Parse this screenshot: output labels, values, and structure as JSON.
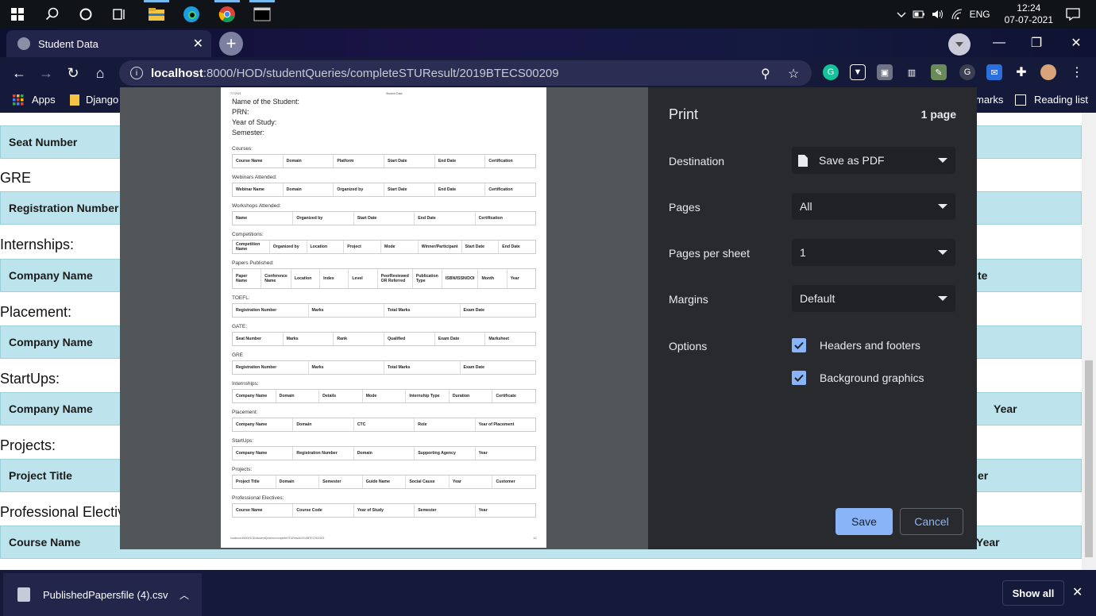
{
  "taskbar": {
    "lang": "ENG",
    "time": "12:24",
    "date": "07-07-2021"
  },
  "browser": {
    "tab_title": "Student Data",
    "url_host": "localhost",
    "url_rest": ":8000/HOD/studentQueries/completeSTUResult/2019BTECS00209",
    "bookmarks": {
      "apps": "Apps",
      "django": "Django",
      "marks_partial": "marks",
      "reading_list": "Reading list"
    }
  },
  "page": {
    "rows": [
      {
        "section": "",
        "header_left": "Seat Number",
        "header_right": ""
      },
      {
        "section": "GRE",
        "header_left": "Registration Number",
        "header_right": ""
      },
      {
        "section": "Internships:",
        "header_left": "Company Name",
        "header_right": "te"
      },
      {
        "section": "Placement:",
        "header_left": "Company Name",
        "header_right": ""
      },
      {
        "section": "StartUps:",
        "header_left": "Company Name",
        "header_right": "Year"
      },
      {
        "section": "Projects:",
        "header_left": "Project Title",
        "header_right": "er"
      },
      {
        "section": "Professional Electiv",
        "header_left": "Course Name",
        "header_right": "Year"
      }
    ]
  },
  "preview": {
    "meta_date": "7/7/2021",
    "meta_title": "Student Data",
    "info": [
      "Name of the Student:",
      "PRN:",
      "Year of Study:",
      "Semester:"
    ],
    "sections": [
      {
        "title": "Courses:",
        "cols": [
          "Course Name",
          "Domain",
          "Platform",
          "Start Date",
          "End Date",
          "Certification"
        ]
      },
      {
        "title": "Webinars Attended:",
        "cols": [
          "Webinar Name",
          "Domain",
          "Organized by",
          "Start Date",
          "End Date",
          "Certification"
        ]
      },
      {
        "title": "Workshops Attended:",
        "cols": [
          "Name",
          "Organized by",
          "Start Date",
          "End Date",
          "Certification"
        ]
      },
      {
        "title": "Competitions:",
        "cols": [
          "Competition Name",
          "Organized by",
          "Location",
          "Project",
          "Mode",
          "Winner/Participant",
          "Start Date",
          "End Date"
        ]
      },
      {
        "title": "Papers Published:",
        "cols": [
          "Paper Name",
          "Conference Name",
          "Location",
          "Index",
          "Level",
          "PeerReviewed OR Referred",
          "Publication Type",
          "ISBN/ISSN/DOI",
          "Month",
          "Year"
        ]
      },
      {
        "title": "TOEFL:",
        "cols": [
          "Registration Number",
          "Marks",
          "Total Marks",
          "Exam Date"
        ]
      },
      {
        "title": "GATE:",
        "cols": [
          "Seat Number",
          "Marks",
          "Rank",
          "Qualified",
          "Exam Date",
          "Marksheet"
        ]
      },
      {
        "title": "GRE",
        "cols": [
          "Registration Number",
          "Marks",
          "Total Marks",
          "Exam Date"
        ]
      },
      {
        "title": "Internships:",
        "cols": [
          "Company Name",
          "Domain",
          "Details",
          "Mode",
          "Internship Type",
          "Duration",
          "Certificate"
        ]
      },
      {
        "title": "Placement:",
        "cols": [
          "Company Name",
          "Domain",
          "CTC",
          "Role",
          "Year of Placement"
        ]
      },
      {
        "title": "StartUps:",
        "cols": [
          "Company Name",
          "Registration Number",
          "Domain",
          "Supporting Agency",
          "Year"
        ]
      },
      {
        "title": "Projects:",
        "cols": [
          "Project Title",
          "Domain",
          "Semester",
          "Guide Name",
          "Social Cause",
          "Year",
          "Customer"
        ]
      },
      {
        "title": "Professional Electives:",
        "cols": [
          "Course Name",
          "Course Code",
          "Year of Study",
          "Semester",
          "Year"
        ]
      }
    ],
    "footer_url": "localhost:8000/HOD/studentQueries/completeSTUResult/2019BTECS00209",
    "footer_page": "1/1"
  },
  "print": {
    "title": "Print",
    "page_count": "1 page",
    "destination_label": "Destination",
    "destination_value": "Save as PDF",
    "pages_label": "Pages",
    "pages_value": "All",
    "pps_label": "Pages per sheet",
    "pps_value": "1",
    "margins_label": "Margins",
    "margins_value": "Default",
    "options_label": "Options",
    "opt_headers": "Headers and footers",
    "opt_background": "Background graphics",
    "save": "Save",
    "cancel": "Cancel"
  },
  "downloads": {
    "file": "PublishedPapersfile (4).csv",
    "show_all": "Show all"
  }
}
